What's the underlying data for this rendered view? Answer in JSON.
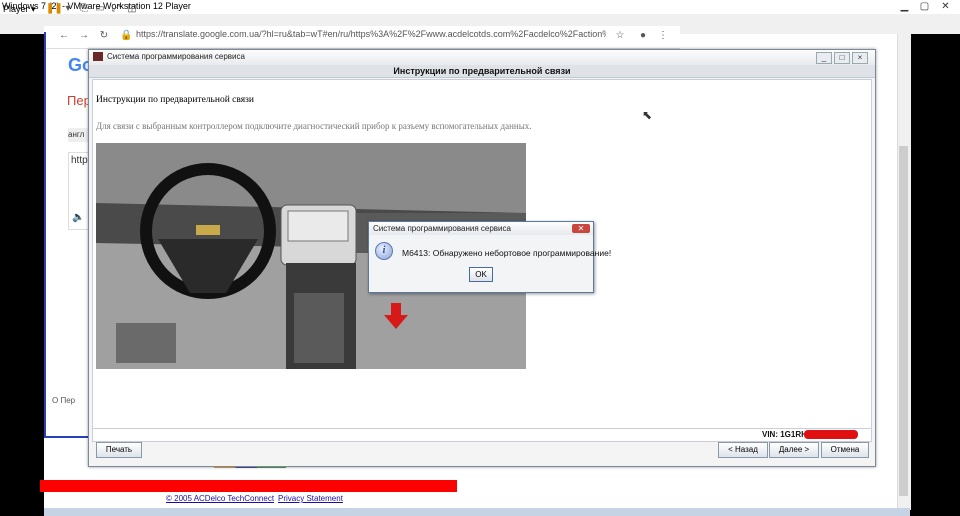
{
  "vmware": {
    "title": "Windows 7 (2) - VMware Workstation 12 Player",
    "player_menu": "Player ▾"
  },
  "browser": {
    "url": "https://translate.google.com.ua/?hl=ru&tab=wT#en/ru/https%3A%2F%2Fwww.acdelcotds.com%2Facdelco%2Faction%2Fsub...",
    "logo": "Go",
    "per_text": "Пер",
    "lang_tab": "англ",
    "input_text": "http",
    "footer_left": "О Пер",
    "copyright": "© 2005 ACDelco TechConnect",
    "privacy": "Privacy Statement"
  },
  "app": {
    "window_title": "Система программирования сервиса",
    "header": "Инструкции по предварительной связи",
    "content_heading": "Инструкции по предварительной связи",
    "content_desc": "Для связи с выбранным контроллером подключите диагностический прибор к разъему вспомогательных данных.",
    "vin_label": "VIN: 1G1RH6",
    "buttons": {
      "print": "Печать",
      "back": "< Назад",
      "next": "Далее >",
      "cancel": "Отмена"
    }
  },
  "modal": {
    "title": "Система программирования сервиса",
    "message": "M6413: Обнаружено небортовое программирование!",
    "ok": "OK"
  },
  "colors": {
    "redaction": "#e01010",
    "red_bar": "#ff0000",
    "arrow": "#d61a1a"
  }
}
